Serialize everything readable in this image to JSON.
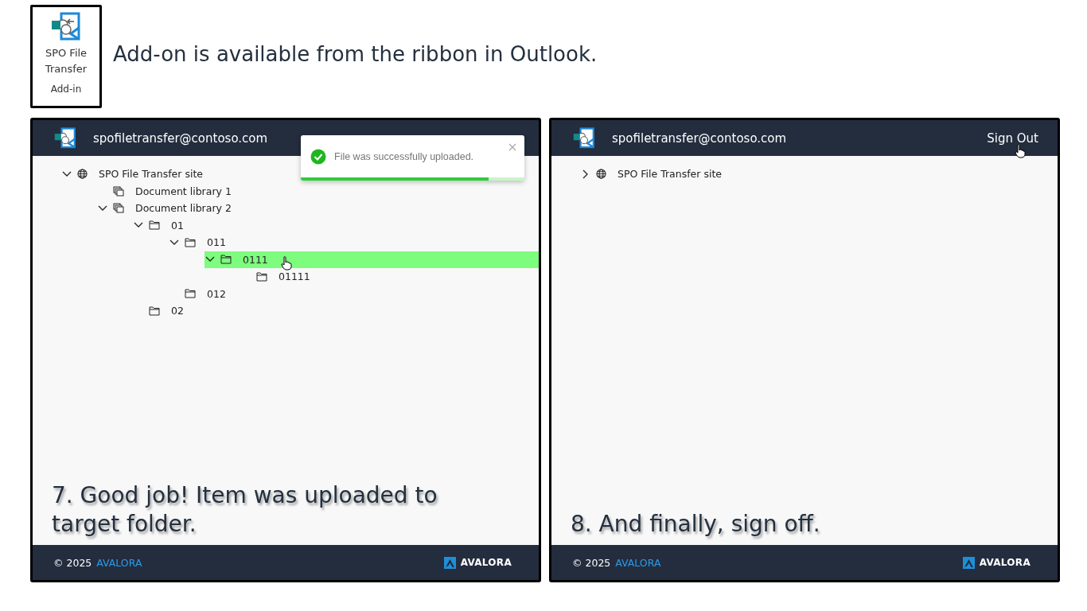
{
  "ribbon": {
    "button_label": "SPO File Transfer",
    "group_label": "Add-in"
  },
  "intro": "Add-on is available from the ribbon in Outlook.",
  "panels": [
    {
      "account": "spofiletransfer@contoso.com",
      "toast": {
        "message": "File was successfully uploaded.",
        "level": 0.84
      },
      "tree": [
        {
          "label": "SPO File Transfer site",
          "kind": "site",
          "expanded": true,
          "selected": false,
          "children": [
            {
              "label": "Document library 1",
              "kind": "library",
              "selected": false
            },
            {
              "label": "Document library 2",
              "kind": "library",
              "expanded": true,
              "selected": false,
              "children": [
                {
                  "label": "01",
                  "kind": "folder",
                  "expanded": true,
                  "selected": false,
                  "children": [
                    {
                      "label": "011",
                      "kind": "folder",
                      "expanded": true,
                      "selected": false,
                      "children": [
                        {
                          "label": "0111",
                          "kind": "folder",
                          "expanded": true,
                          "selected": true,
                          "pointer": true,
                          "children": [
                            {
                              "label": "01111",
                              "kind": "folder",
                              "selected": false
                            }
                          ]
                        }
                      ]
                    },
                    {
                      "label": "012",
                      "kind": "folder",
                      "selected": false
                    }
                  ]
                },
                {
                  "label": "02",
                  "kind": "folder",
                  "selected": false
                }
              ]
            }
          ]
        }
      ],
      "caption": "7. Good job! Item was uploaded to target folder.",
      "footer": {
        "copyright": "© 2025",
        "brand_link": "AVALORA",
        "logo_text": "AVALORA"
      }
    },
    {
      "account": "spofiletransfer@contoso.com",
      "sign_out": "Sign Out",
      "tree": [
        {
          "label": "SPO File Transfer site",
          "kind": "site",
          "expanded": false,
          "selected": false
        }
      ],
      "caption": "8. And finally, sign off.",
      "footer": {
        "copyright": "© 2025",
        "brand_link": "AVALORA",
        "logo_text": "AVALORA"
      }
    }
  ]
}
